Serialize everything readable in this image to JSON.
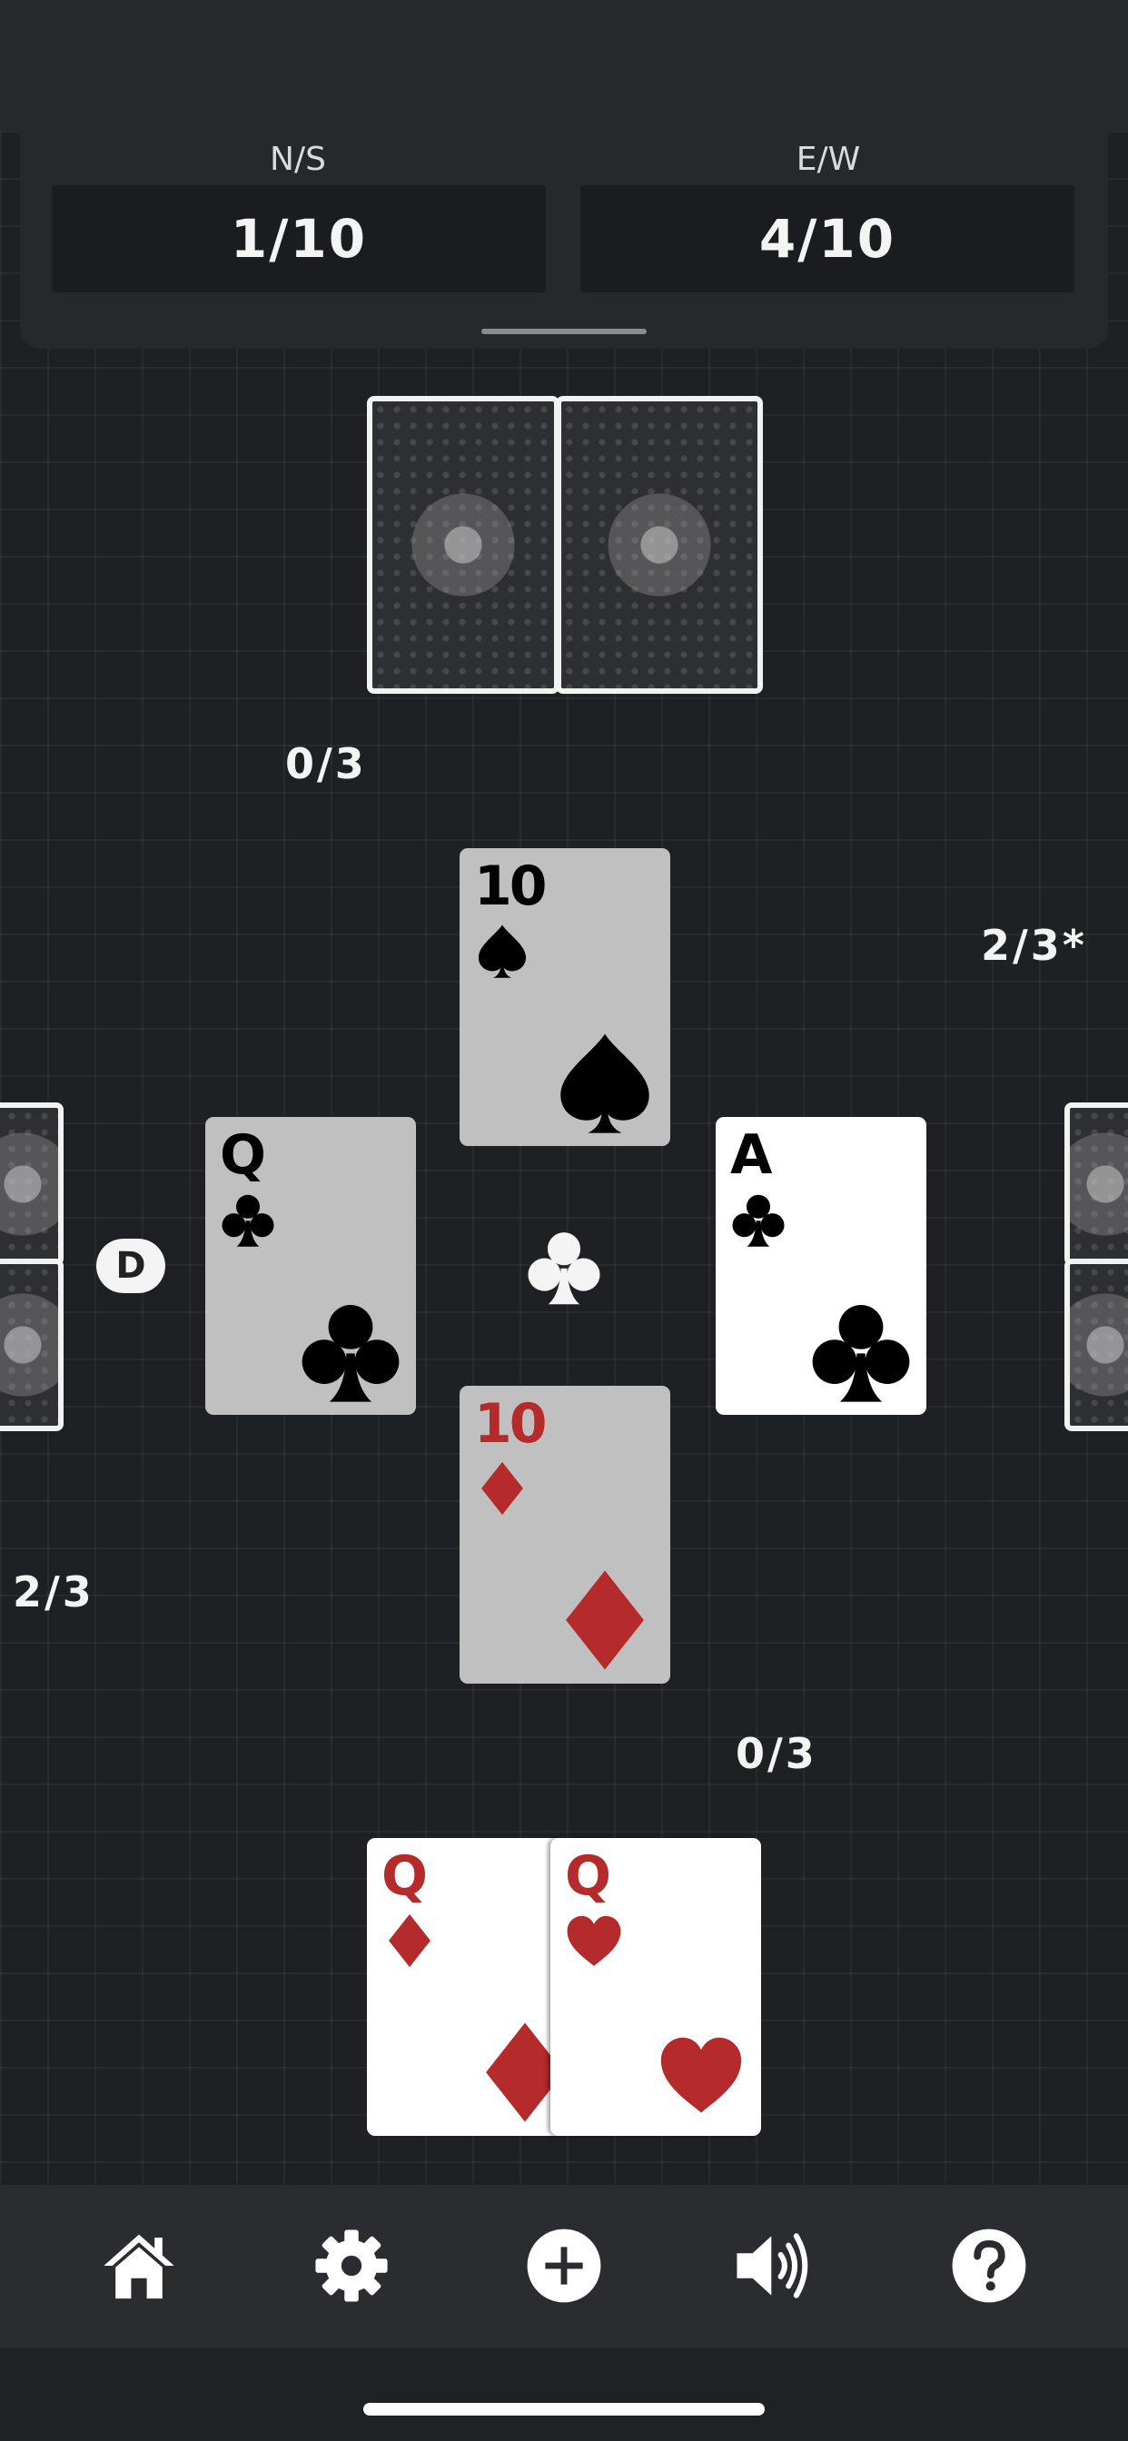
{
  "score": {
    "ns": {
      "label": "N/S",
      "value": "1/10"
    },
    "ew": {
      "label": "E/W",
      "value": "4/10"
    }
  },
  "tricks": {
    "north": "0/3",
    "east": "2/3*",
    "west": "2/3",
    "south": "0/3"
  },
  "dealer_marker": "D",
  "lead_suit": "clubs",
  "played": {
    "north": {
      "rank": "10",
      "suit": "spades"
    },
    "west": {
      "rank": "Q",
      "suit": "clubs"
    },
    "east": {
      "rank": "A",
      "suit": "clubs"
    },
    "south": {
      "rank": "10",
      "suit": "diamonds"
    }
  },
  "hand": [
    {
      "rank": "Q",
      "suit": "diamonds"
    },
    {
      "rank": "Q",
      "suit": "hearts"
    }
  ],
  "toolbar": [
    "home-icon",
    "gear-icon",
    "plus-circle-icon",
    "speaker-icon",
    "help-icon"
  ],
  "colors": {
    "red_suit": "#b52a2a",
    "black_suit": "#000000",
    "background": "#1e2024"
  }
}
